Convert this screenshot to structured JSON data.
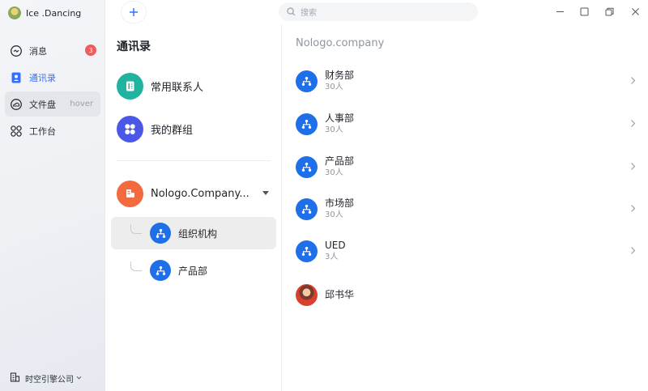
{
  "user": {
    "name": "Ice .Dancing"
  },
  "nav": [
    {
      "label": "消息",
      "icon": "message-icon",
      "badge": "3"
    },
    {
      "label": "通讯录",
      "icon": "contacts-icon",
      "active": true
    },
    {
      "label": "文件盘",
      "icon": "cloud-drive-icon",
      "hover_tag": "hover"
    },
    {
      "label": "工作台",
      "icon": "workbench-icon"
    }
  ],
  "company_switcher": {
    "label": "时空引擎公司"
  },
  "search": {
    "placeholder": "搜索"
  },
  "contacts": {
    "title": "通讯录",
    "frequent_label": "常用联系人",
    "groups_label": "我的群组",
    "org_name": "Nologo.Company...",
    "sub_items": [
      {
        "label": "组织机构",
        "selected": true
      },
      {
        "label": "产品部"
      }
    ]
  },
  "org_panel": {
    "title": "Nologo.company",
    "departments": [
      {
        "name": "财务部",
        "count": "30人"
      },
      {
        "name": "人事部",
        "count": "30人"
      },
      {
        "name": "产品部",
        "count": "30人"
      },
      {
        "name": "市场部",
        "count": "30人"
      },
      {
        "name": "UED",
        "count": "3人"
      }
    ],
    "person": {
      "name": "邱书华"
    }
  },
  "colors": {
    "accent": "#3370ff",
    "dept_blue": "#1e6fe8",
    "teal": "#21b3a0",
    "indigo": "#4b57e6",
    "orange": "#f26a3d",
    "badge": "#f25c5c"
  }
}
